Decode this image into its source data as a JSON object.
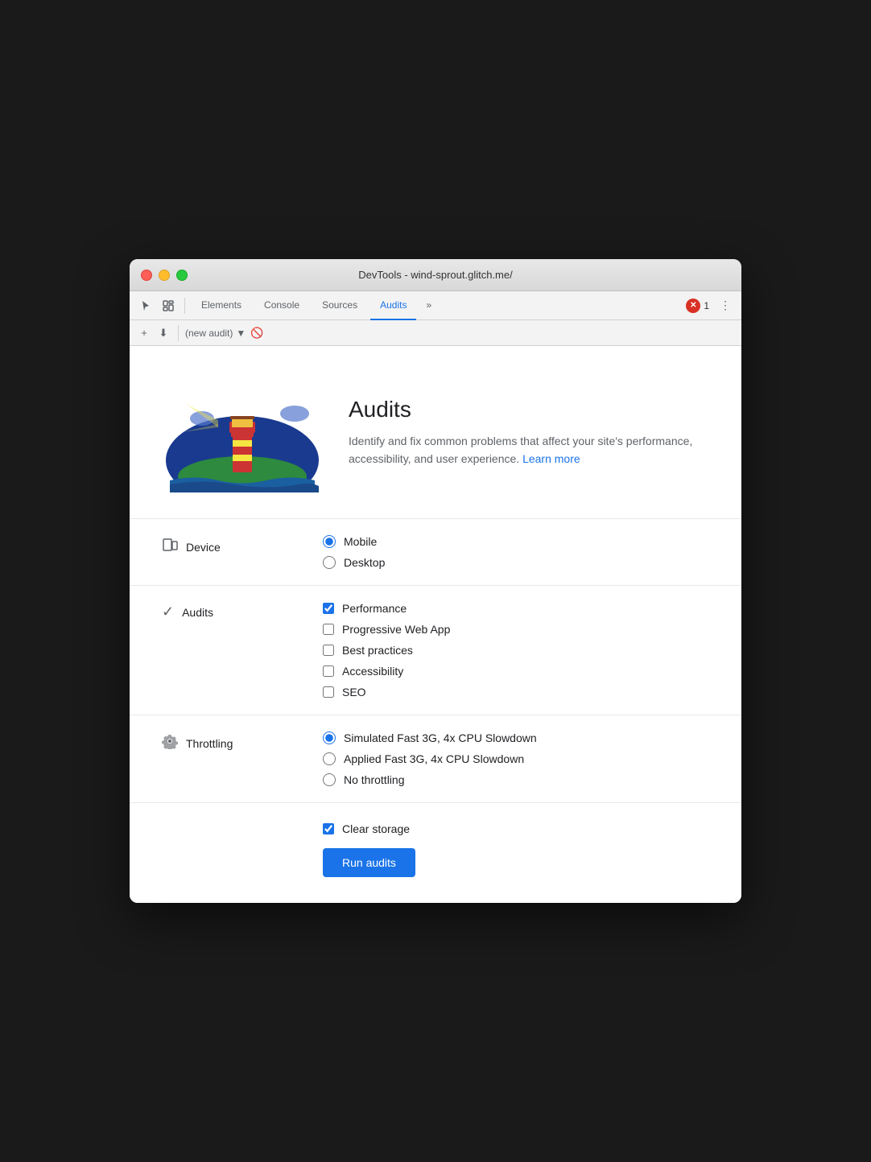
{
  "window": {
    "title": "DevTools - wind-sprout.glitch.me/"
  },
  "tabs": [
    {
      "id": "elements",
      "label": "Elements",
      "active": false
    },
    {
      "id": "console",
      "label": "Console",
      "active": false
    },
    {
      "id": "sources",
      "label": "Sources",
      "active": false
    },
    {
      "id": "audits",
      "label": "Audits",
      "active": true
    },
    {
      "id": "more",
      "label": "»",
      "active": false
    }
  ],
  "toolbar": {
    "audit_select": "(new audit)",
    "error_count": "1"
  },
  "hero": {
    "title": "Audits",
    "description": "Identify and fix common problems that affect your site's performance, accessibility, and user experience.",
    "learn_more": "Learn more"
  },
  "device": {
    "label": "Device",
    "options": [
      {
        "id": "mobile",
        "label": "Mobile",
        "checked": true
      },
      {
        "id": "desktop",
        "label": "Desktop",
        "checked": false
      }
    ]
  },
  "audits_section": {
    "label": "Audits",
    "options": [
      {
        "id": "performance",
        "label": "Performance",
        "checked": true
      },
      {
        "id": "pwa",
        "label": "Progressive Web App",
        "checked": false
      },
      {
        "id": "best-practices",
        "label": "Best practices",
        "checked": false
      },
      {
        "id": "accessibility",
        "label": "Accessibility",
        "checked": false
      },
      {
        "id": "seo",
        "label": "SEO",
        "checked": false
      }
    ]
  },
  "throttling": {
    "label": "Throttling",
    "options": [
      {
        "id": "simulated",
        "label": "Simulated Fast 3G, 4x CPU Slowdown",
        "checked": true
      },
      {
        "id": "applied",
        "label": "Applied Fast 3G, 4x CPU Slowdown",
        "checked": false
      },
      {
        "id": "none",
        "label": "No throttling",
        "checked": false
      }
    ]
  },
  "clear_storage": {
    "label": "Clear storage",
    "checked": true
  },
  "run_button": {
    "label": "Run audits"
  }
}
